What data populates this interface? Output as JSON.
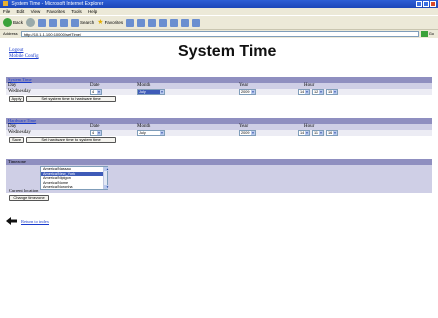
{
  "window": {
    "title": "System Time - Microsoft Internet Explorer"
  },
  "menu": [
    "File",
    "Edit",
    "View",
    "Favorites",
    "Tools",
    "Help"
  ],
  "toolbar": {
    "back": "Back",
    "search": "Search",
    "favorites": "Favorites"
  },
  "address": {
    "label": "Address",
    "url": "http://10.1.1.100:10000/setTime/",
    "go": "Go"
  },
  "nav": {
    "logout": "Logout",
    "mobile_config": "Mobile Config"
  },
  "page_title": "System Time",
  "system_time": {
    "header": "System Time",
    "columns": {
      "day": "Day",
      "date": "Date",
      "month": "Month",
      "year": "Year",
      "hour": "Hour"
    },
    "day": "Wednesday",
    "date": "4",
    "month": "July",
    "year": "2009",
    "hour": "14",
    "minute": "12",
    "second": "15",
    "apply_label": "Apply",
    "sync_label": "Set system time to hardware time"
  },
  "hardware_time": {
    "header": "Hardware Time",
    "columns": {
      "day": "Day",
      "date": "Date",
      "month": "Month",
      "year": "Year",
      "hour": "Hour"
    },
    "day": "Wednesday",
    "date": "4",
    "month": "July",
    "year": "2009",
    "hour": "14",
    "minute": "11",
    "second": "16",
    "save_label": "Save",
    "sync_label": "Set hardware time to system time"
  },
  "timezone": {
    "header": "Timezone",
    "options": [
      "America/Nassau",
      "America/New_York",
      "America/Nipigon",
      "America/Nome",
      "America/Noronha"
    ],
    "selected_index": 1,
    "current_label": "Current location",
    "change_label": "Change timezone"
  },
  "return_link": "Return to index"
}
